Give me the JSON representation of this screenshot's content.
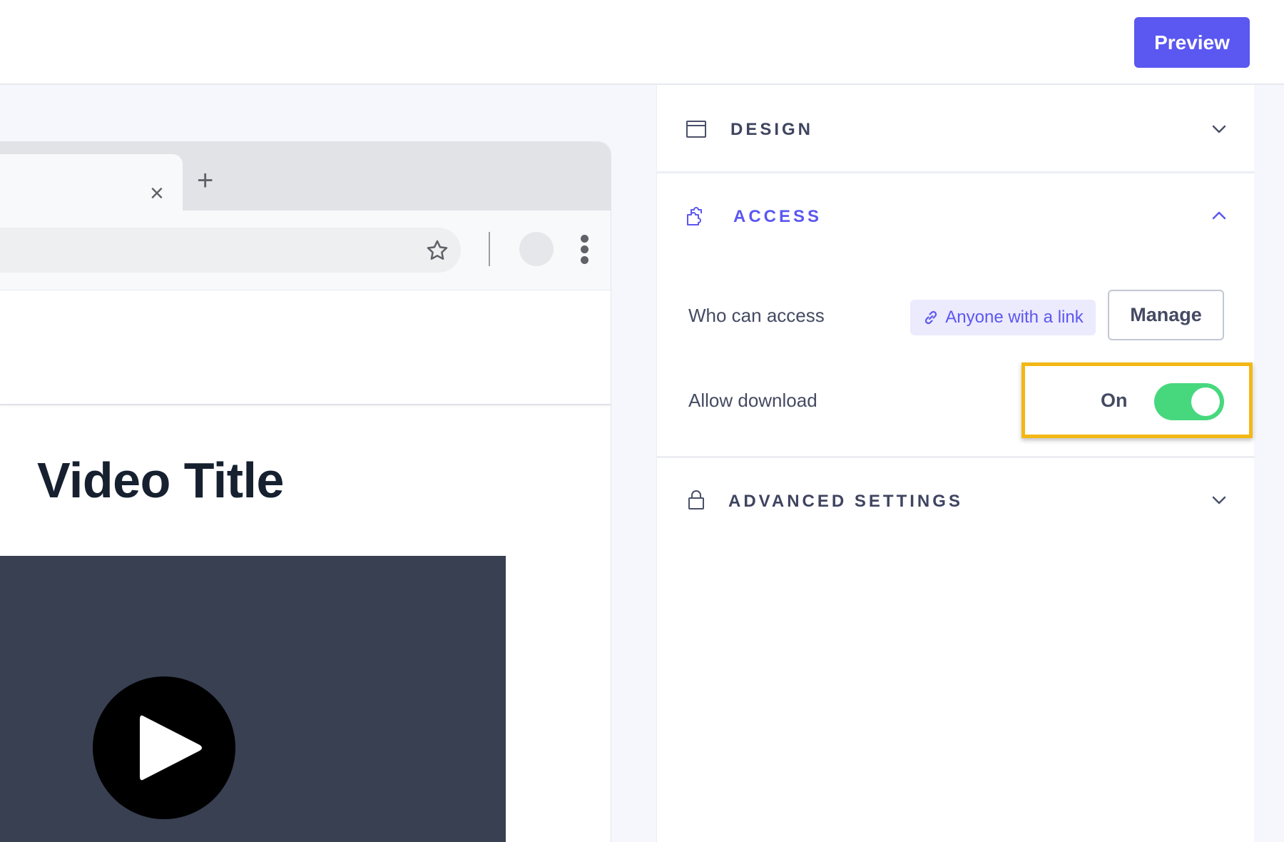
{
  "header": {
    "preview_label": "Preview"
  },
  "browser": {
    "tab_close_glyph": "×",
    "new_tab_glyph": "+",
    "video_title": "Video Title"
  },
  "panel": {
    "sections": [
      {
        "id": "design",
        "title": "DESIGN",
        "icon": "window-icon",
        "expanded": false
      },
      {
        "id": "access",
        "title": "ACCESS",
        "icon": "puzzle-icon",
        "expanded": true
      },
      {
        "id": "advanced",
        "title": "ADVANCED SETTINGS",
        "icon": "lock-icon",
        "expanded": false
      }
    ],
    "access": {
      "who_label": "Who can access",
      "who_value": "Anyone with a link",
      "manage_label": "Manage",
      "download_label": "Allow download",
      "download_state": "On",
      "download_enabled": true
    }
  },
  "colors": {
    "accent": "#5b57f1",
    "toggle_on": "#47d87e",
    "highlight": "#f3b716",
    "video_bg": "#384052"
  }
}
